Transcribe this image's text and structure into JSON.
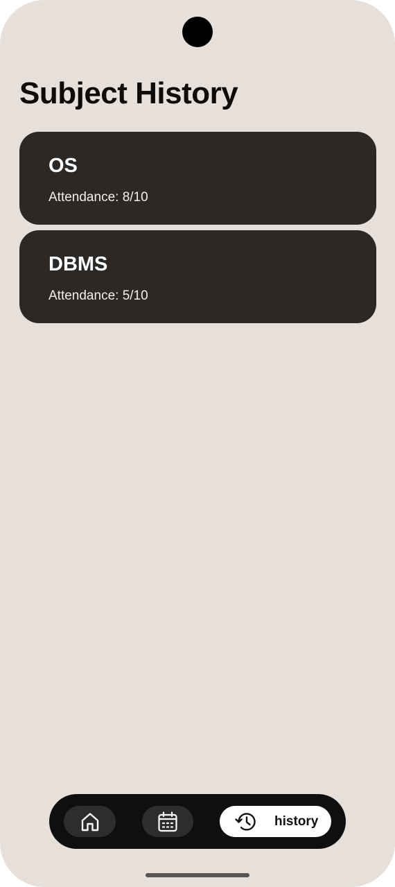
{
  "page": {
    "title": "Subject History"
  },
  "subjects": [
    {
      "name": "OS",
      "attendance": "Attendance: 8/10"
    },
    {
      "name": "DBMS",
      "attendance": "Attendance: 5/10"
    }
  ],
  "nav": {
    "items": [
      {
        "id": "home",
        "icon": "home-icon",
        "label": "",
        "active": false
      },
      {
        "id": "calendar",
        "icon": "calendar-icon",
        "label": "",
        "active": false
      },
      {
        "id": "history",
        "icon": "history-icon",
        "label": "history",
        "active": true
      }
    ]
  },
  "colors": {
    "background": "#e7e0da",
    "card": "#2b2826",
    "nav_bar": "#0f0f0f",
    "nav_inactive": "#2d2d2d",
    "nav_active": "#ffffff"
  }
}
